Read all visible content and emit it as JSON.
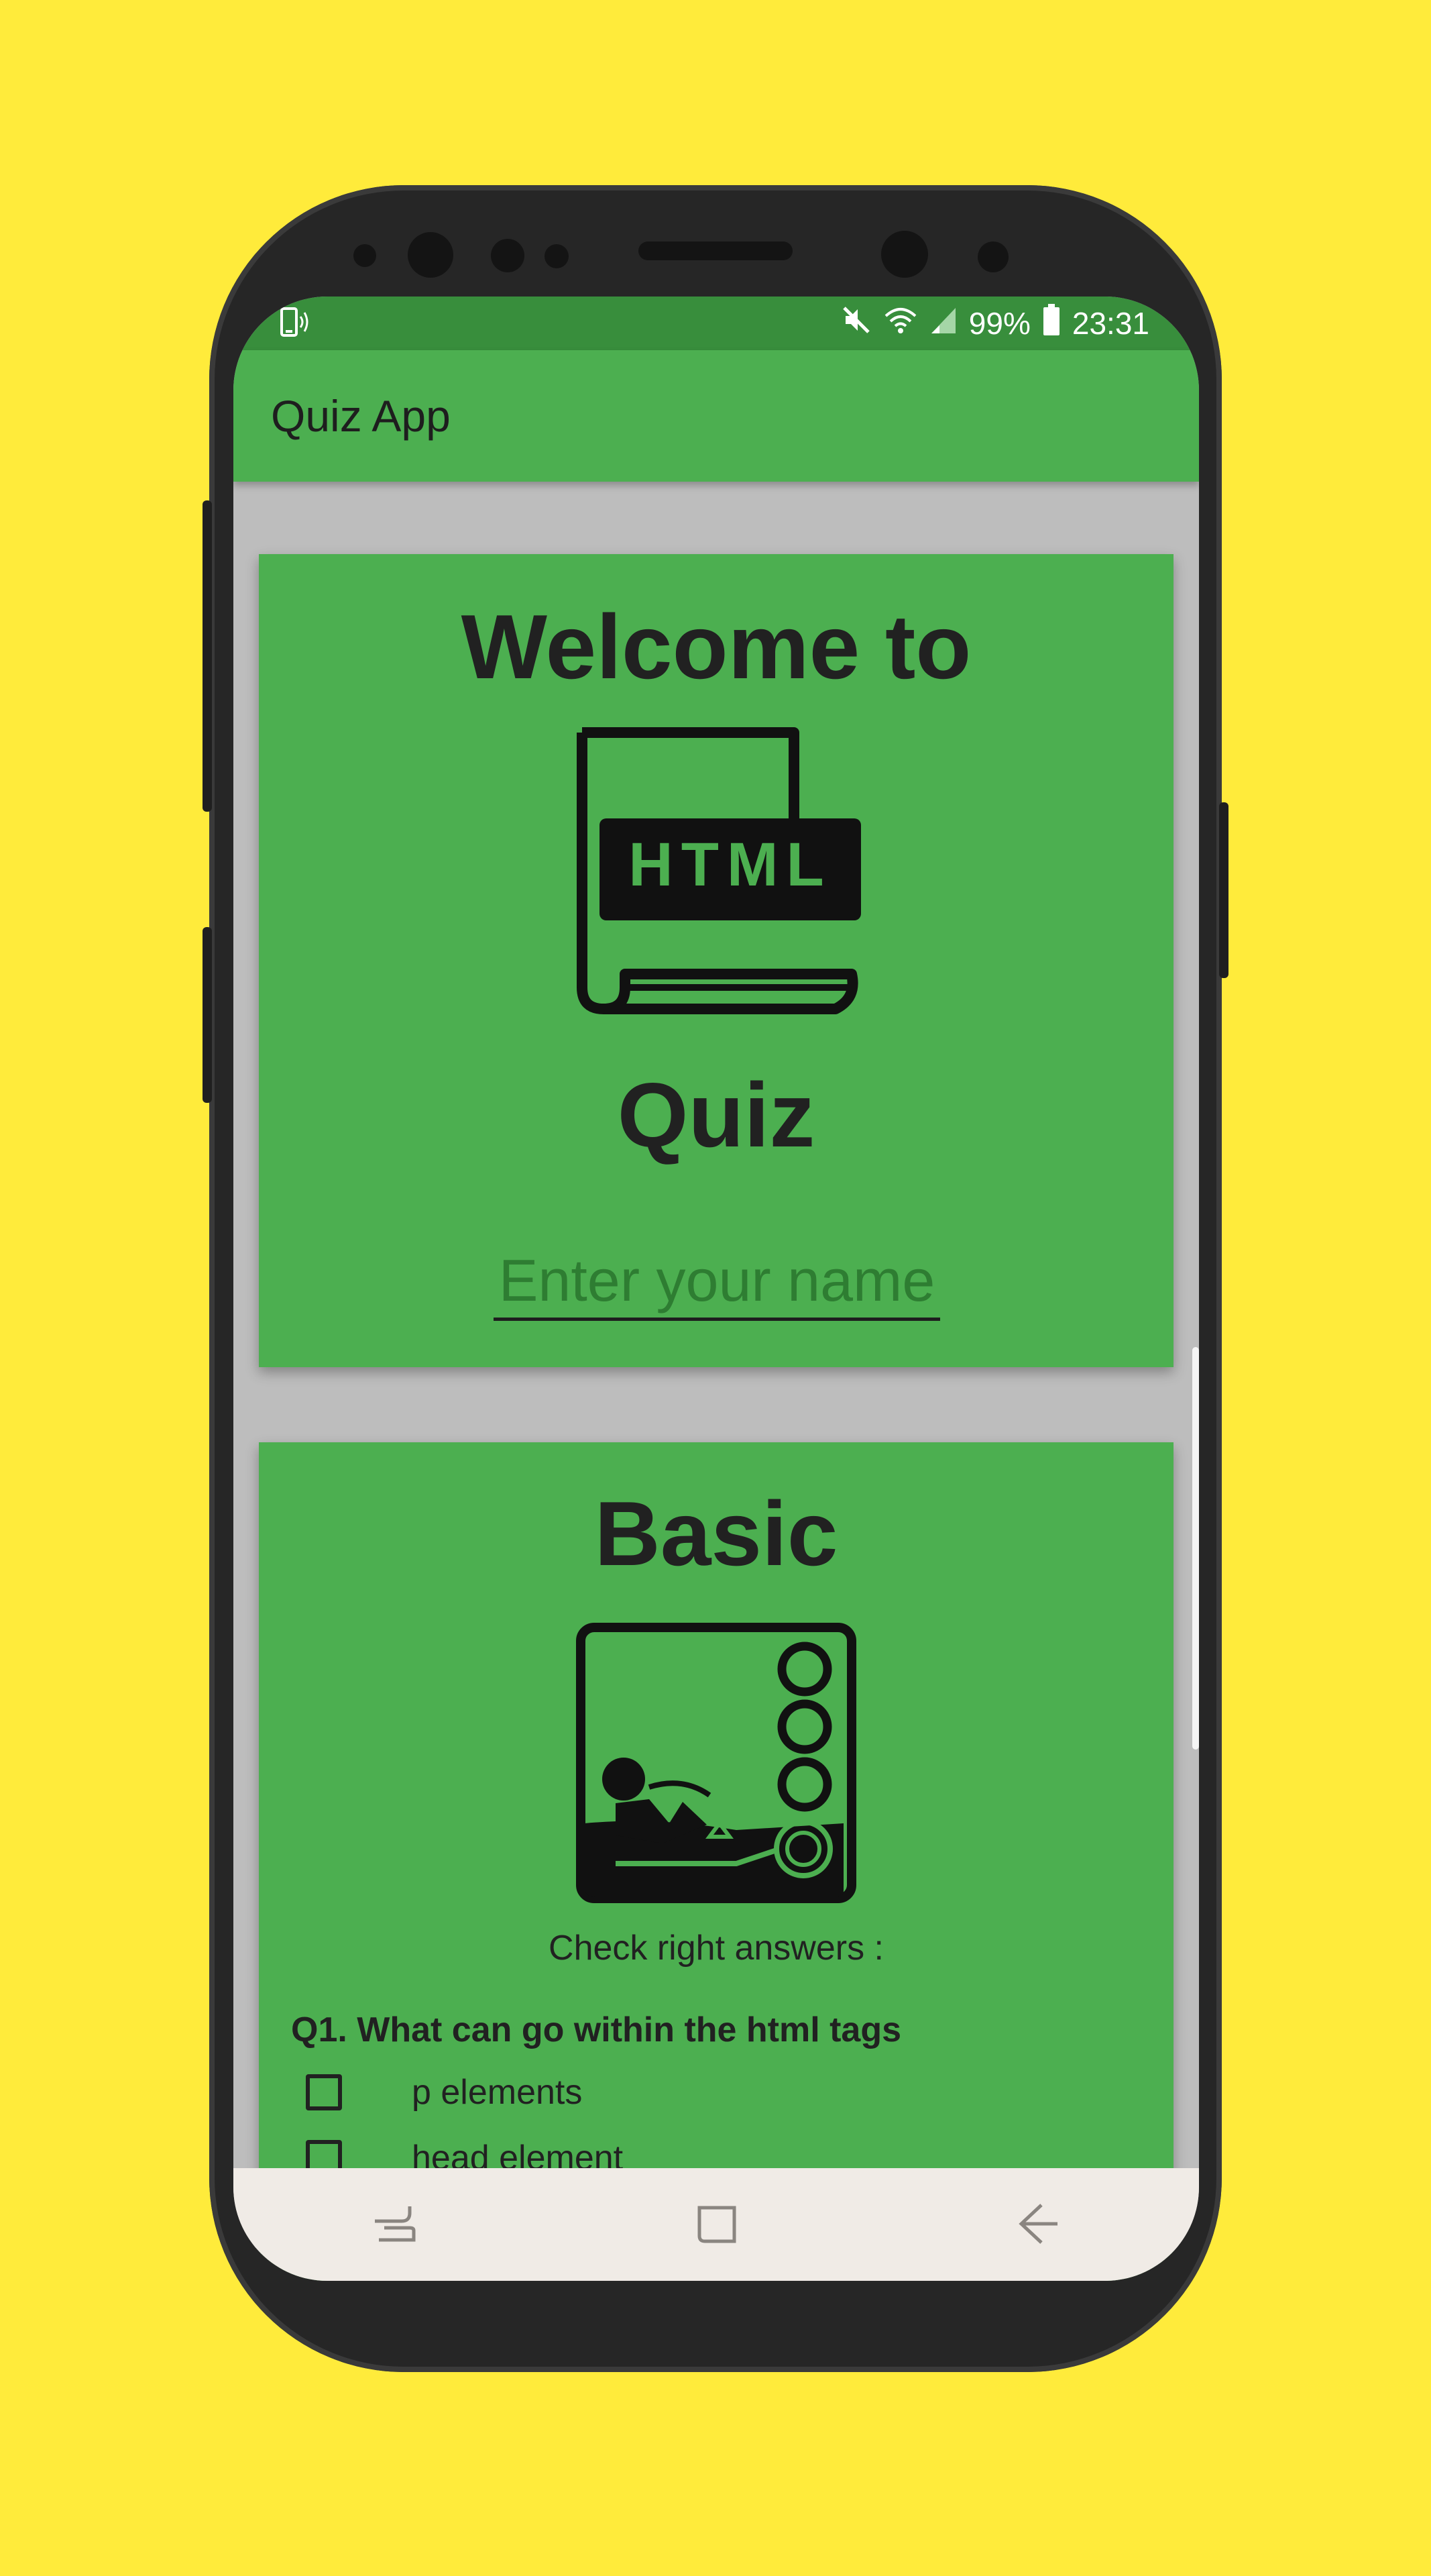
{
  "status_bar": {
    "battery": "99%",
    "time": "23:31"
  },
  "app_bar": {
    "title": "Quiz App"
  },
  "welcome_card": {
    "title_top": "Welcome to",
    "logo_text": "HTML",
    "title_bottom": "Quiz",
    "name_input": {
      "placeholder": "Enter your name",
      "value": ""
    }
  },
  "basic_card": {
    "title": "Basic",
    "instruction": "Check right answers :",
    "question": "Q1. What can go within the html tags",
    "options": [
      {
        "label": "p elements",
        "checked": false
      },
      {
        "label": "head element",
        "checked": false
      }
    ]
  },
  "colors": {
    "background": "#ffeb3b",
    "primary": "#4caf50",
    "primary_dark": "#388e3c",
    "content_bg": "#bdbdbd"
  },
  "icons": {
    "status_left": "vibrate-phone-icon",
    "mute": "mute-icon",
    "wifi": "wifi-icon",
    "signal": "signal-icon",
    "battery": "battery-icon",
    "nav_recent": "recent-apps-icon",
    "nav_home": "home-icon",
    "nav_back": "back-icon"
  }
}
